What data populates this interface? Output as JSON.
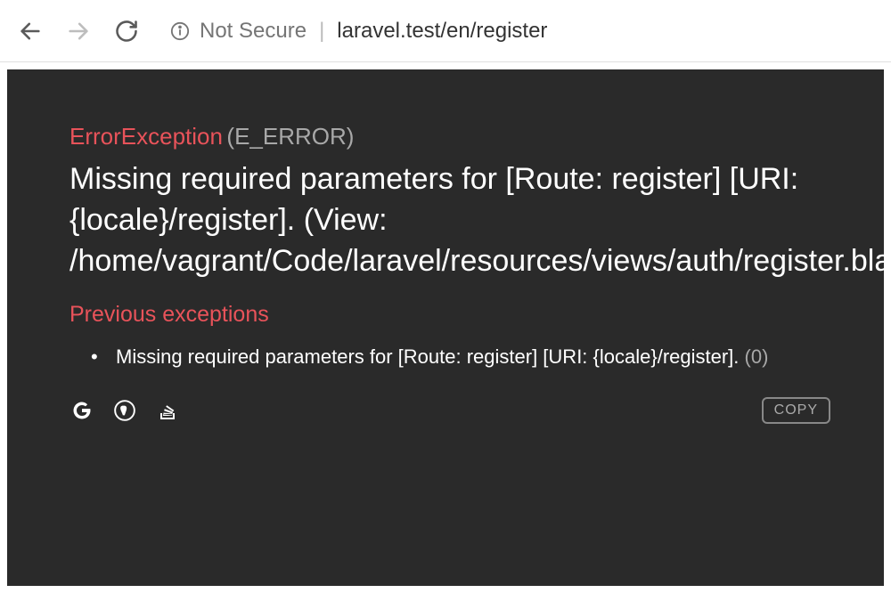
{
  "browser": {
    "not_secure": "Not Secure",
    "url": "laravel.test/en/register"
  },
  "error": {
    "exception_class": "ErrorException",
    "exception_code": "(E_ERROR)",
    "message": "Missing required parameters for [Route: register] [URI: {locale}/register]. (View: /home/vagrant/Code/laravel/resources/views/auth/register.blade.php)",
    "previous_heading": "Previous exceptions",
    "previous": [
      {
        "message": "Missing required parameters for [Route: register] [URI: {locale}/register].",
        "code": "(0)"
      }
    ],
    "copy_label": "COPY"
  }
}
